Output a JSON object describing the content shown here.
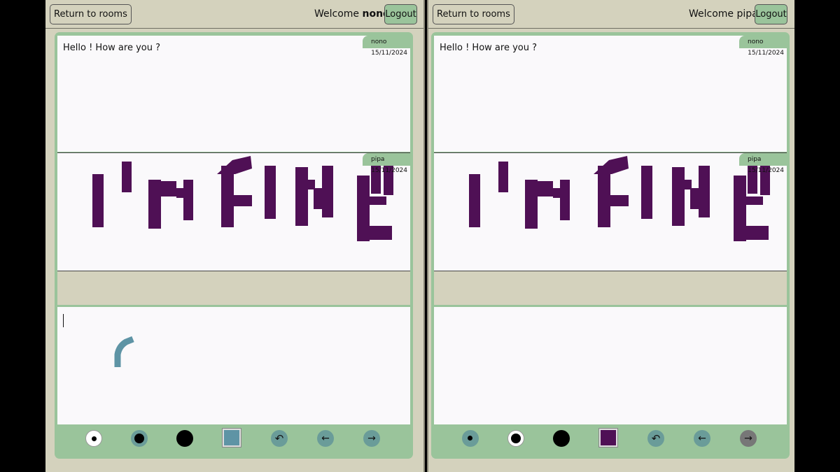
{
  "left": {
    "return_label": "Return to rooms",
    "welcome_prefix": "Welcome ",
    "username": "nono",
    "welcome_suffix": "!",
    "logout_label": "Logout",
    "messages": [
      {
        "author": "nono",
        "date": "15/11/2024",
        "text": "Hello ! How are you ?"
      },
      {
        "author": "pipa",
        "date": "15/11/2024",
        "text": ""
      }
    ],
    "current_color": "#5e94a5"
  },
  "right": {
    "return_label": "Return to rooms",
    "welcome_prefix": "Welcome ",
    "username": "pipa",
    "welcome_suffix": "!",
    "logout_label": "Logout",
    "messages": [
      {
        "author": "nono",
        "date": "15/11/2024",
        "text": "Hello ! How are you ?"
      },
      {
        "author": "pipa",
        "date": "15/11/2024",
        "text": ""
      }
    ],
    "current_color": "#4f1055"
  },
  "colors": {
    "panel_bg": "#d4d2bd",
    "accent_green": "#9ac49b",
    "drawing_purple": "#4f1055",
    "tool_teal": "#6a9c99"
  },
  "icons": {
    "brush_small": "brush-size-small-icon",
    "brush_medium": "brush-size-medium-icon",
    "brush_large": "brush-size-large-icon",
    "undo": "undo-icon",
    "prev": "arrow-left-icon",
    "next": "arrow-right-icon"
  }
}
